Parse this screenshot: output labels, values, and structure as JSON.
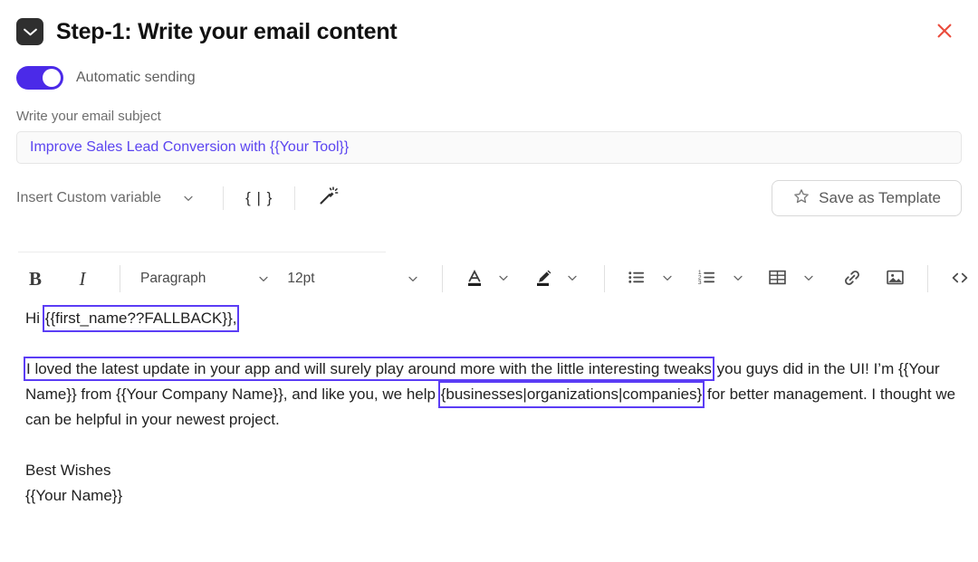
{
  "header": {
    "icon": "envelope-icon",
    "title": "Step-1: Write your email content",
    "close_icon": "close-icon",
    "close_color": "#ea4b3c"
  },
  "toggle": {
    "label": "Automatic sending",
    "state": "on",
    "accent_color": "#4b2ae8"
  },
  "subject": {
    "label": "Write your email subject",
    "value": "Improve Sales Lead Conversion with {{Your Tool}}",
    "placeholder": "Write your email subject",
    "text_color": "#5b45f0"
  },
  "variable_toolbar": {
    "insert_variable_label": "Insert Custom variable",
    "caret_icon": "chevron-down-icon",
    "spintax_icon_label": "{ | }",
    "magic_icon": "magic-wand-icon",
    "save_template_label": "Save as Template",
    "star_icon": "star-icon"
  },
  "format_toolbar": {
    "bold": "B",
    "italic": "I",
    "block_format": "Paragraph",
    "font_size": "12pt",
    "text_color_icon": "text-color-icon",
    "highlight_icon": "highlight-color-icon",
    "bullet_list_icon": "bullet-list-icon",
    "numbered_list_icon": "numbered-list-icon",
    "table_icon": "table-icon",
    "link_icon": "link-icon",
    "image_icon": "image-icon",
    "code_icon": "source-code-icon",
    "undo_icon": "undo-icon",
    "caret_icon": "chevron-down-icon"
  },
  "body": {
    "greeting_prefix": "Hi ",
    "greeting_variable": "{{first_name??FALLBACK}},",
    "para_highlight": "I loved the latest update in your app and will surely play around more with the little interesting tweaks",
    "para_rest_1": " you guys did in the UI! I’m {{Your Name}} from {{Your Company Name}}, and like you, we help ",
    "spintax": "{businesses|organizations|companies}",
    "para_rest_2": " for better management. I thought we can be helpful in your newest project.",
    "signoff": "Best Wishes",
    "signature": "{{Your Name}}",
    "highlight_color": "#5b3df5"
  }
}
